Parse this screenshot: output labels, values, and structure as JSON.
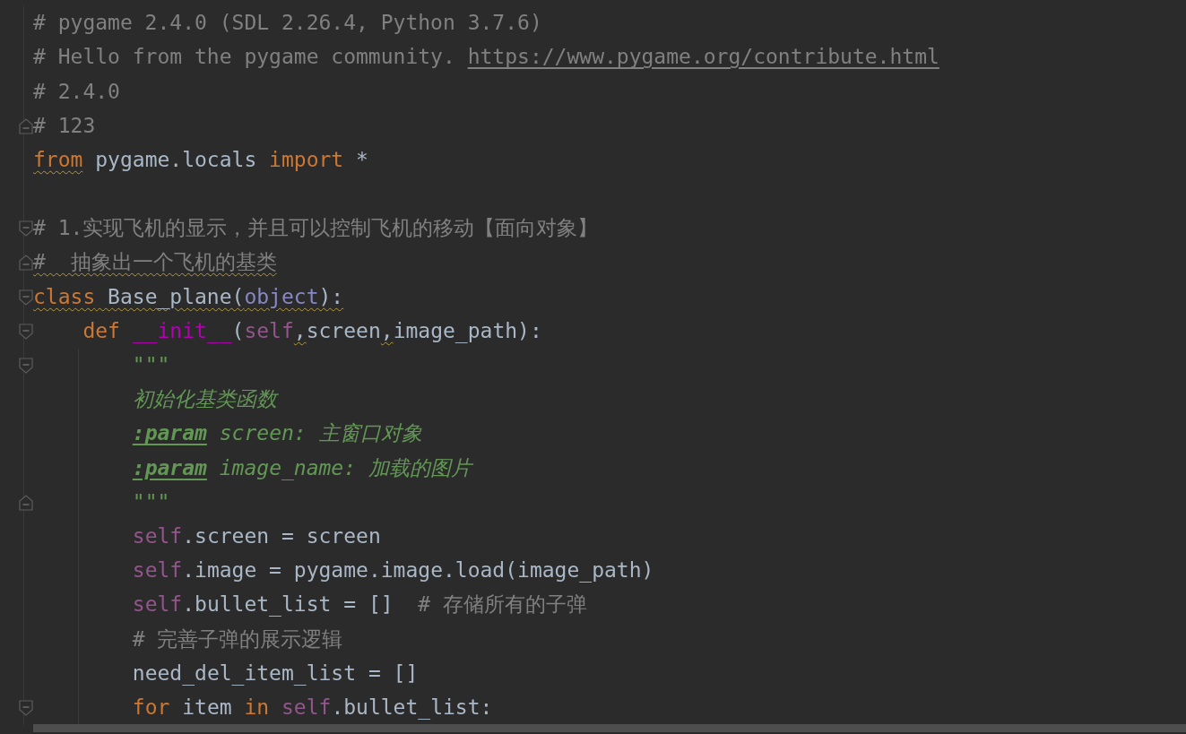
{
  "editor": {
    "lines": [
      {
        "kind": "code",
        "tokens": [
          {
            "kind": "comment",
            "text": "# pygame 2.4.0 (SDL 2.26.4, Python 3.7.6)",
            "warning": false
          }
        ]
      },
      {
        "kind": "code",
        "tokens": [
          {
            "kind": "comment",
            "text": "# Hello from the pygame community. ",
            "warning": false
          },
          {
            "kind": "link",
            "text": "https://www.pygame.org/contribute.html",
            "warning": false
          }
        ]
      },
      {
        "kind": "code",
        "tokens": [
          {
            "kind": "comment",
            "text": "# 2.4.0",
            "warning": false
          }
        ]
      },
      {
        "kind": "code",
        "fold_marker": {
          "kind": "end"
        },
        "tokens": [
          {
            "kind": "comment",
            "text": "# 123",
            "warning": false
          }
        ]
      },
      {
        "kind": "code",
        "tokens": [
          {
            "kind": "keyword",
            "text": "from",
            "warning": true
          },
          {
            "kind": "plain",
            "text": " pygame.locals ",
            "warning": false
          },
          {
            "kind": "keyword",
            "text": "import",
            "warning": false
          },
          {
            "kind": "plain",
            "text": " *",
            "warning": false
          }
        ]
      },
      {
        "kind": "blank"
      },
      {
        "kind": "code",
        "fold_marker": {
          "kind": "start"
        },
        "tokens": [
          {
            "kind": "comment",
            "text": "# 1.实现飞机的显示，并且可以控制飞机的移动【面向对象】",
            "warning": false
          }
        ]
      },
      {
        "kind": "code",
        "fold_marker": {
          "kind": "end"
        },
        "tokens": [
          {
            "kind": "comment",
            "text": "#  抽象出一个飞机的基类",
            "warning": true
          }
        ]
      },
      {
        "kind": "code",
        "fold_marker": {
          "kind": "start"
        },
        "tokens": [
          {
            "kind": "keyword",
            "text": "class",
            "warning": true
          },
          {
            "kind": "plain",
            "text": " Base_plane(",
            "warning": true
          },
          {
            "kind": "builtin",
            "text": "object",
            "warning": true
          },
          {
            "kind": "plain",
            "text": "):",
            "warning": true
          }
        ],
        "children": [
          {
            "kind": "code",
            "fold_marker": {
              "kind": "start"
            },
            "tokens": [
              {
                "kind": "keyword",
                "text": "def ",
                "warning": false
              },
              {
                "kind": "magic",
                "text": "__init__",
                "warning": false
              },
              {
                "kind": "plain",
                "text": "(",
                "warning": false
              },
              {
                "kind": "self",
                "text": "self",
                "warning": false
              },
              {
                "kind": "plain",
                "text": ",",
                "warning": true
              },
              {
                "kind": "plain",
                "text": "screen",
                "warning": false
              },
              {
                "kind": "plain",
                "text": ",",
                "warning": true
              },
              {
                "kind": "plain",
                "text": "image_path):",
                "warning": false
              }
            ],
            "children": [
              {
                "kind": "code",
                "fold_marker": {
                  "kind": "start"
                },
                "tokens": [
                  {
                    "kind": "docstring",
                    "text": "\"\"\"",
                    "warning": false
                  }
                ]
              },
              {
                "kind": "code",
                "tokens": [
                  {
                    "kind": "docstring",
                    "text": "初始化基类函数",
                    "warning": false
                  }
                ]
              },
              {
                "kind": "code",
                "tokens": [
                  {
                    "kind": "doctag",
                    "text": ":param",
                    "warning": false
                  },
                  {
                    "kind": "docstring",
                    "text": " screen: 主窗口对象",
                    "warning": false
                  }
                ]
              },
              {
                "kind": "code",
                "tokens": [
                  {
                    "kind": "doctag",
                    "text": ":param",
                    "warning": false
                  },
                  {
                    "kind": "docstring",
                    "text": " image_name: 加载的图片",
                    "warning": false
                  }
                ]
              },
              {
                "kind": "code",
                "fold_marker": {
                  "kind": "end"
                },
                "tokens": [
                  {
                    "kind": "docstring",
                    "text": "\"\"\"",
                    "warning": false
                  }
                ]
              },
              {
                "kind": "code",
                "tokens": [
                  {
                    "kind": "self",
                    "text": "self",
                    "warning": false
                  },
                  {
                    "kind": "plain",
                    "text": ".screen = screen",
                    "warning": false
                  }
                ]
              },
              {
                "kind": "code",
                "tokens": [
                  {
                    "kind": "self",
                    "text": "self",
                    "warning": false
                  },
                  {
                    "kind": "plain",
                    "text": ".image = pygame.image.load(image_path)",
                    "warning": false
                  }
                ]
              },
              {
                "kind": "code",
                "tokens": [
                  {
                    "kind": "self",
                    "text": "self",
                    "warning": false
                  },
                  {
                    "kind": "plain",
                    "text": ".bullet_list = []  ",
                    "warning": false
                  },
                  {
                    "kind": "comment",
                    "text": "# 存储所有的子弹",
                    "warning": false
                  }
                ]
              },
              {
                "kind": "code",
                "tokens": [
                  {
                    "kind": "comment",
                    "text": "# 完善子弹的展示逻辑",
                    "warning": false
                  }
                ]
              },
              {
                "kind": "code",
                "tokens": [
                  {
                    "kind": "plain",
                    "text": "need_del_item_list = []",
                    "warning": false
                  }
                ]
              },
              {
                "kind": "code",
                "fold_marker": {
                  "kind": "start"
                },
                "tokens": [
                  {
                    "kind": "keyword",
                    "text": "for",
                    "warning": false
                  },
                  {
                    "kind": "plain",
                    "text": " item ",
                    "warning": false
                  },
                  {
                    "kind": "keyword",
                    "text": "in ",
                    "warning": false
                  },
                  {
                    "kind": "self",
                    "text": "self",
                    "warning": false
                  },
                  {
                    "kind": "plain",
                    "text": ".bullet_list:",
                    "warning": false
                  }
                ]
              }
            ]
          }
        ]
      }
    ]
  }
}
